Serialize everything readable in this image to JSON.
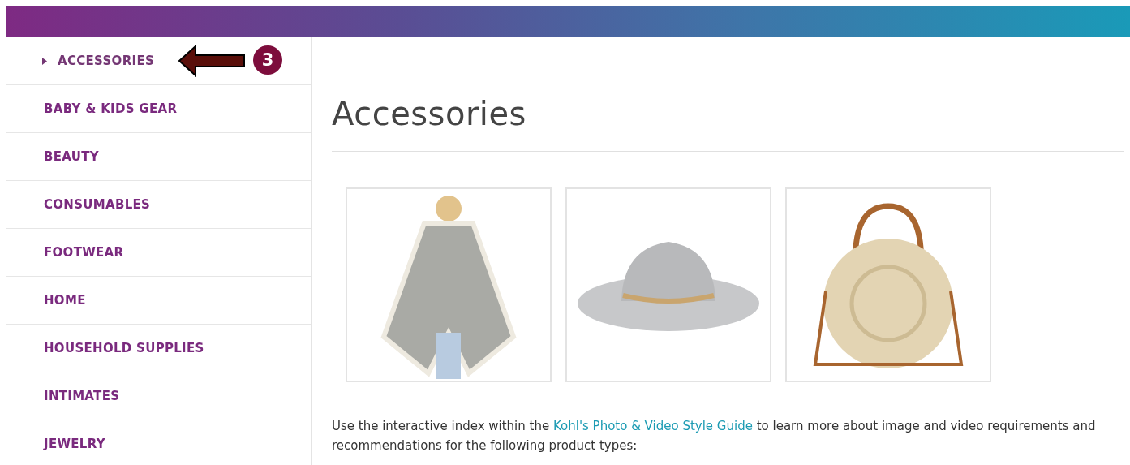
{
  "sidebar": {
    "items": [
      {
        "label": "ACCESSORIES",
        "selected": true
      },
      {
        "label": "BABY & KIDS GEAR",
        "selected": false
      },
      {
        "label": "BEAUTY",
        "selected": false
      },
      {
        "label": "CONSUMABLES",
        "selected": false
      },
      {
        "label": "FOOTWEAR",
        "selected": false
      },
      {
        "label": "HOME",
        "selected": false
      },
      {
        "label": "HOUSEHOLD SUPPLIES",
        "selected": false
      },
      {
        "label": "INTIMATES",
        "selected": false
      },
      {
        "label": "JEWELRY",
        "selected": false
      }
    ]
  },
  "annotation": {
    "step": "3"
  },
  "main": {
    "title": "Accessories",
    "images": [
      {
        "kind": "poncho"
      },
      {
        "kind": "hat"
      },
      {
        "kind": "bag"
      }
    ],
    "intro": {
      "before": "Use the interactive index within the ",
      "link": "Kohl's Photo & Video Style Guide",
      "after": " to learn more about image and video requirements and recommendations for the following product types:"
    }
  }
}
